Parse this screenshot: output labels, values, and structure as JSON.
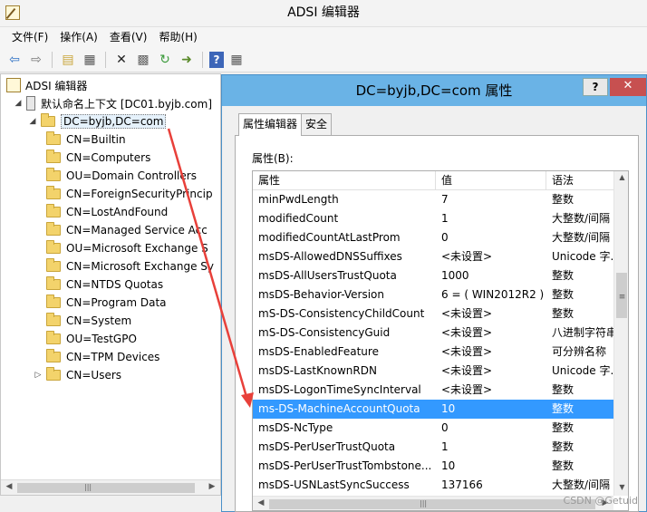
{
  "window": {
    "title": "ADSI 编辑器"
  },
  "menu": [
    "文件(F)",
    "操作(A)",
    "查看(V)",
    "帮助(H)"
  ],
  "toolbar": {
    "buttons": [
      "back-icon",
      "forward-icon",
      "folder-up-icon",
      "show-tree-icon",
      "delete-icon",
      "properties-icon",
      "refresh-icon",
      "export-icon",
      "help-icon",
      "panel-icon"
    ]
  },
  "tree": {
    "root": "ADSI 编辑器",
    "context": "默认命名上下文 [DC01.byjb.com]",
    "domain": "DC=byjb,DC=com",
    "children": [
      "CN=Builtin",
      "CN=Computers",
      "OU=Domain Controllers",
      "CN=ForeignSecurityPrincip",
      "CN=LostAndFound",
      "CN=Managed Service Acc",
      "OU=Microsoft Exchange S",
      "CN=Microsoft Exchange Sy",
      "CN=NTDS Quotas",
      "CN=Program Data",
      "CN=System",
      "OU=TestGPO",
      "CN=TPM Devices",
      "CN=Users"
    ]
  },
  "dialog": {
    "title": "DC=byjb,DC=com 属性",
    "help": "?",
    "close": "✕",
    "tabs": [
      "属性编辑器",
      "安全"
    ],
    "attributes_label": "属性(B):",
    "columns": [
      "属性",
      "值",
      "语法"
    ],
    "rows": [
      {
        "attr": "minPwdLength",
        "value": "7",
        "syntax": "整数"
      },
      {
        "attr": "modifiedCount",
        "value": "1",
        "syntax": "大整数/间隔"
      },
      {
        "attr": "modifiedCountAtLastProm",
        "value": "0",
        "syntax": "大整数/间隔"
      },
      {
        "attr": "msDS-AllowedDNSSuffixes",
        "value": "<未设置>",
        "syntax": "Unicode 字..."
      },
      {
        "attr": "msDS-AllUsersTrustQuota",
        "value": "1000",
        "syntax": "整数"
      },
      {
        "attr": "msDS-Behavior-Version",
        "value": "6 = ( WIN2012R2 )",
        "syntax": "整数"
      },
      {
        "attr": "mS-DS-ConsistencyChildCount",
        "value": "<未设置>",
        "syntax": "整数"
      },
      {
        "attr": "mS-DS-ConsistencyGuid",
        "value": "<未设置>",
        "syntax": "八进制字符串"
      },
      {
        "attr": "msDS-EnabledFeature",
        "value": "<未设置>",
        "syntax": "可分辨名称"
      },
      {
        "attr": "msDS-LastKnownRDN",
        "value": "<未设置>",
        "syntax": "Unicode 字..."
      },
      {
        "attr": "msDS-LogonTimeSyncInterval",
        "value": "<未设置>",
        "syntax": "整数"
      },
      {
        "attr": "ms-DS-MachineAccountQuota",
        "value": "10",
        "syntax": "整数"
      },
      {
        "attr": "msDS-NcType",
        "value": "0",
        "syntax": "整数"
      },
      {
        "attr": "msDS-PerUserTrustQuota",
        "value": "1",
        "syntax": "整数"
      },
      {
        "attr": "msDS-PerUserTrustTombstone...",
        "value": "10",
        "syntax": "整数"
      },
      {
        "attr": "msDS-USNLastSyncSuccess",
        "value": "137166",
        "syntax": "大整数/间隔"
      }
    ],
    "selected_row": 11
  },
  "watermark": "CSDN @Getuid",
  "colors": {
    "selection": "#3399ff",
    "dialog_title": "#6ab3e6",
    "close": "#c75050",
    "annotation_arrow": "#e8403a"
  }
}
